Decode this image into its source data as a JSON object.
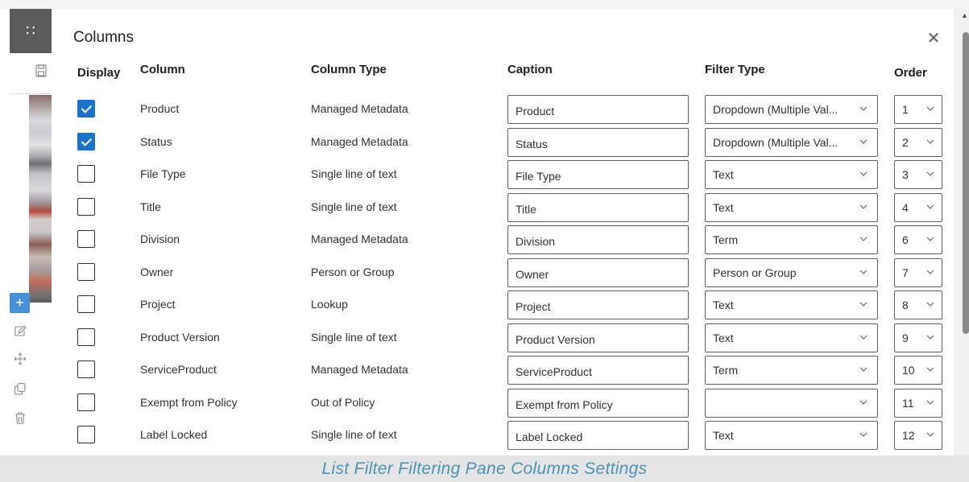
{
  "panel": {
    "title": "Columns",
    "close_icon": "close-icon"
  },
  "headers": {
    "display": "Display",
    "column": "Column",
    "column_type": "Column Type",
    "caption": "Caption",
    "filter_type": "Filter Type",
    "order": "Order"
  },
  "rows": [
    {
      "checked": true,
      "column": "Product",
      "type": "Managed Metadata",
      "caption": "Product",
      "filter": "Dropdown (Multiple Val...",
      "order": "1"
    },
    {
      "checked": true,
      "column": "Status",
      "type": "Managed Metadata",
      "caption": "Status",
      "filter": "Dropdown (Multiple Val...",
      "order": "2"
    },
    {
      "checked": false,
      "column": "File Type",
      "type": "Single line of text",
      "caption": "File Type",
      "filter": "Text",
      "order": "3"
    },
    {
      "checked": false,
      "column": "Title",
      "type": "Single line of text",
      "caption": "Title",
      "filter": "Text",
      "order": "4"
    },
    {
      "checked": false,
      "column": "Division",
      "type": "Managed Metadata",
      "caption": "Division",
      "filter": "Term",
      "order": "6"
    },
    {
      "checked": false,
      "column": "Owner",
      "type": "Person or Group",
      "caption": "Owner",
      "filter": "Person or Group",
      "order": "7"
    },
    {
      "checked": false,
      "column": "Project",
      "type": "Lookup",
      "caption": "Project",
      "filter": "Text",
      "order": "8"
    },
    {
      "checked": false,
      "column": "Product Version",
      "type": "Single line of text",
      "caption": "Product Version",
      "filter": "Text",
      "order": "9"
    },
    {
      "checked": false,
      "column": "ServiceProduct",
      "type": "Managed Metadata",
      "caption": "ServiceProduct",
      "filter": "Term",
      "order": "10"
    },
    {
      "checked": false,
      "column": "Exempt from Policy",
      "type": "Out of Policy",
      "caption": "Exempt from Policy",
      "filter": "",
      "order": "11"
    },
    {
      "checked": false,
      "column": "Label Locked",
      "type": "Single line of text",
      "caption": "Label Locked",
      "filter": "Text",
      "order": "12"
    }
  ],
  "figure_caption": "List Filter Filtering Pane Columns Settings",
  "colors": {
    "accent": "#1a73c9",
    "caption_text": "#4c93b8",
    "rail_button": "#4a90d9"
  },
  "icons": {
    "waffle": "app-launcher-icon",
    "save": "save-icon",
    "add": "plus-icon",
    "edit": "edit-icon",
    "move": "move-icon",
    "copy": "copy-icon",
    "delete": "trash-icon",
    "chevron": "chevron-down-icon",
    "check": "checkmark-icon"
  }
}
